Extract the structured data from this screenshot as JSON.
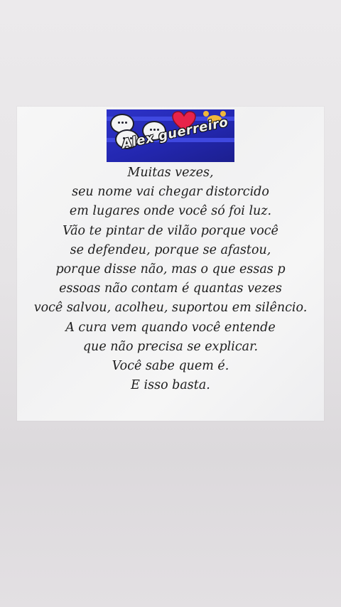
{
  "image": {
    "watermark_handle": "Alex guerreiro",
    "icons": [
      "speech-bubble-icon",
      "speech-bubble-icon",
      "speech-bubble-icon",
      "heart-icon",
      "paw-icon"
    ],
    "colors": {
      "banner": "#2a2fc0",
      "background": "#e6e4e6",
      "card": "#f4f4f5",
      "text": "#1e1e1e"
    }
  },
  "poem": {
    "lines": [
      "Muitas vezes,",
      "seu nome vai chegar distorcido",
      "em lugares onde você só foi luz.",
      "Vão te pintar de vilão porque você",
      "se defendeu, porque se afastou,",
      "porque disse não, mas o que essas p",
      "essoas não contam é quantas vezes",
      "você salvou, acolheu, suportou em silêncio.",
      "A cura vem quando você entende",
      "que não precisa se explicar.",
      "Você sabe quem é.",
      "E isso basta."
    ]
  }
}
